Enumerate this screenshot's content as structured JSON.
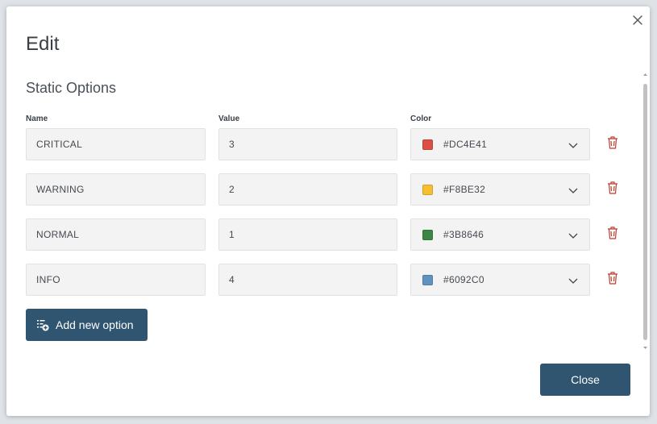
{
  "dialog": {
    "title": "Edit",
    "section_title": "Static Options",
    "columns": {
      "name": "Name",
      "value": "Value",
      "color": "Color"
    },
    "options": [
      {
        "name": "CRITICAL",
        "value": "3",
        "color": "#DC4E41"
      },
      {
        "name": "WARNING",
        "value": "2",
        "color": "#F8BE32"
      },
      {
        "name": "NORMAL",
        "value": "1",
        "color": "#3B8646"
      },
      {
        "name": "INFO",
        "value": "4",
        "color": "#6092C0"
      }
    ],
    "add_label": "Add new option",
    "close_label": "Close"
  },
  "icons": {
    "close": "close-icon",
    "delete": "trash-icon",
    "dropdown": "chevron-down-icon",
    "add": "add-list-icon"
  },
  "theme": {
    "primary_button": "#2F5571",
    "delete_icon": "#C0392B",
    "field_bg": "#F3F3F4"
  }
}
